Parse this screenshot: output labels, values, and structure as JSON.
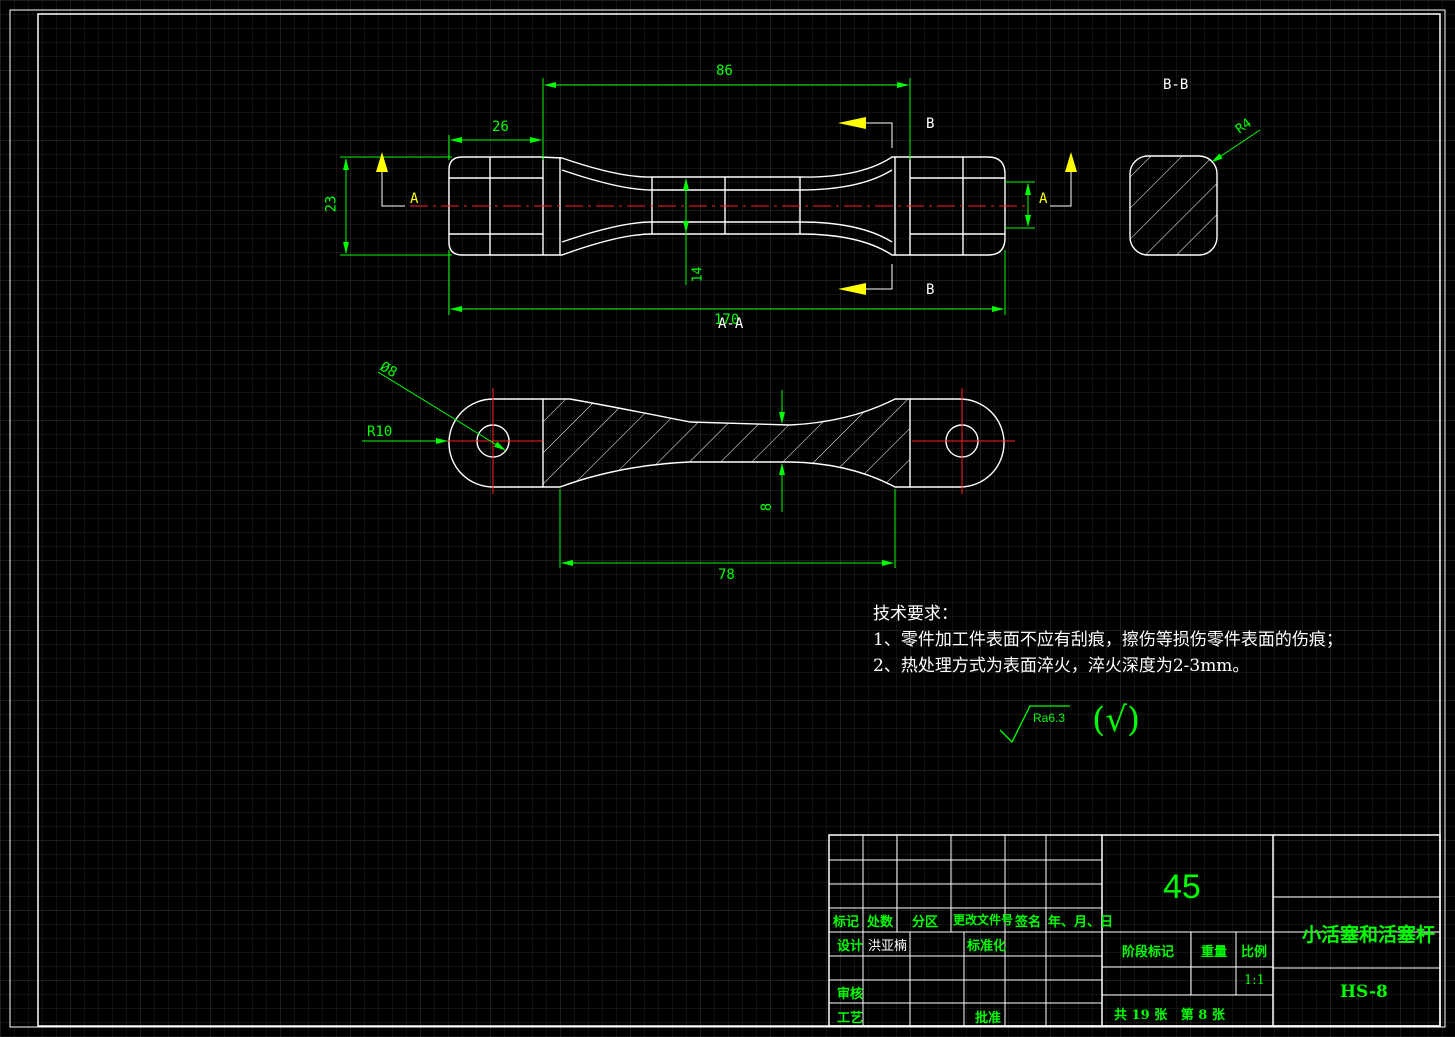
{
  "colors": {
    "background": "#000000",
    "grid_minor": "#262626",
    "grid_major": "#3a3a3a",
    "outline": "#ffffff",
    "dimension": "#00ff00",
    "centerline": "#ff2020",
    "arrow": "#ffff00",
    "title_text": "#00ff00"
  },
  "views": {
    "top_section_label": "A-A",
    "side_section_label": "B-B",
    "cut_label_a": "A",
    "cut_label_b": "B"
  },
  "dimensions": {
    "total_length": "170",
    "center_span": "86",
    "end_width": "26",
    "height": "23",
    "neck_height": "14",
    "corner_radius_bb": "R4",
    "hole_diameter": "Ø8",
    "end_radius": "R10",
    "web_thickness": "8",
    "web_length": "78"
  },
  "notes": {
    "title": "技术要求：",
    "line1": "1、零件加工件表面不应有刮痕，擦伤等损伤零件表面的伤痕；",
    "line2": "2、热处理方式为表面淬火，淬火深度为2-3mm。"
  },
  "roughness": {
    "value": "Ra6.3",
    "mark": "(√)"
  },
  "title_block": {
    "material": "45",
    "part_name": "小活塞和活塞杆",
    "drawing_no": "HS-8",
    "headers": [
      "标记",
      "处数",
      "分区",
      "更改文件号",
      "签名",
      "年、月、日"
    ],
    "design_label": "设计",
    "designer": "洪亚楠",
    "standardization_label": "标准化",
    "review_label": "审核",
    "process_label": "工艺",
    "approval_label": "批准",
    "stage_mark_label": "阶段标记",
    "weight_label": "重量",
    "scale_label": "比例",
    "scale": "1:1",
    "sheet_info": "共 19 张   第 8 张"
  }
}
